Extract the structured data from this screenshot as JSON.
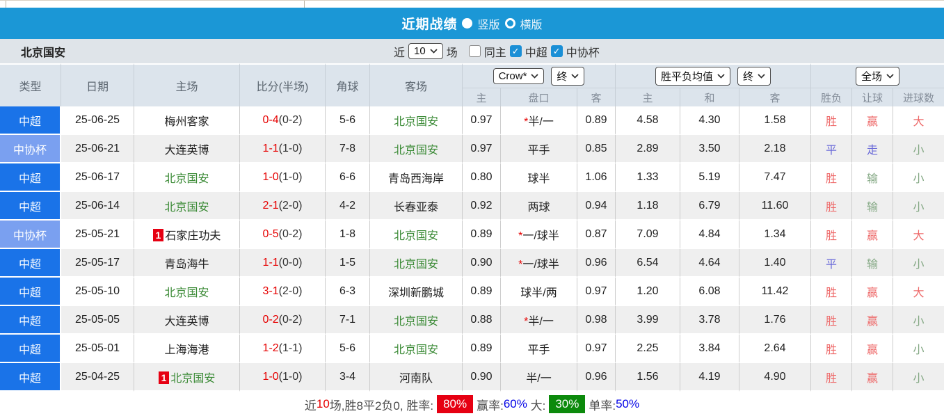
{
  "title_bar": {
    "title": "近期战绩",
    "radio_vertical": "竖版",
    "radio_horizontal": "横版"
  },
  "filter_bar": {
    "team": "北京国安",
    "recent_label": "近",
    "recent_value": "10",
    "matches_label": "场",
    "same_venue_label": "同主",
    "league_label": "中超",
    "cup_label": "中协杯",
    "same_venue_checked": false,
    "league_checked": true,
    "cup_checked": true
  },
  "table": {
    "headers_left": [
      "类型",
      "日期",
      "主场",
      "比分(半场)",
      "角球",
      "客场"
    ],
    "controls": {
      "bookmaker_select": "Crow*",
      "bookmaker_period_select": "终",
      "avg_select": "胜平负均值",
      "avg_period_select": "终",
      "scope_select": "全场"
    },
    "sub_headers": [
      "主",
      "盘口",
      "客",
      "主",
      "和",
      "客",
      "胜负",
      "让球",
      "进球数"
    ],
    "rows": [
      {
        "type": "中超",
        "is_cup": false,
        "date": "25-06-25",
        "home": "梅州客家",
        "home_focus": false,
        "home_badge": "",
        "score": "0-4",
        "half": "(0-2)",
        "corners": "5-6",
        "away": "北京国安",
        "away_focus": true,
        "odds_home": "0.97",
        "handicap_star": true,
        "handicap": "半/一",
        "odds_away": "0.89",
        "avg_home": "4.58",
        "avg_draw": "4.30",
        "avg_away": "1.58",
        "result": "胜",
        "result_color": "red",
        "handicap_result": "赢",
        "handicap_result_color": "red",
        "goals": "大",
        "goals_color": "red"
      },
      {
        "type": "中协杯",
        "is_cup": true,
        "date": "25-06-21",
        "home": "大连英博",
        "home_focus": false,
        "home_badge": "",
        "score": "1-1",
        "half": "(1-0)",
        "corners": "7-8",
        "away": "北京国安",
        "away_focus": true,
        "odds_home": "0.97",
        "handicap_star": false,
        "handicap": "平手",
        "odds_away": "0.85",
        "avg_home": "2.89",
        "avg_draw": "3.50",
        "avg_away": "2.18",
        "result": "平",
        "result_color": "blue",
        "handicap_result": "走",
        "handicap_result_color": "blue",
        "goals": "小",
        "goals_color": "green"
      },
      {
        "type": "中超",
        "is_cup": false,
        "date": "25-06-17",
        "home": "北京国安",
        "home_focus": true,
        "home_badge": "",
        "score": "1-0",
        "half": "(1-0)",
        "corners": "6-6",
        "away": "青岛西海岸",
        "away_focus": false,
        "odds_home": "0.80",
        "handicap_star": false,
        "handicap": "球半",
        "odds_away": "1.06",
        "avg_home": "1.33",
        "avg_draw": "5.19",
        "avg_away": "7.47",
        "result": "胜",
        "result_color": "red",
        "handicap_result": "输",
        "handicap_result_color": "green",
        "goals": "小",
        "goals_color": "green"
      },
      {
        "type": "中超",
        "is_cup": false,
        "date": "25-06-14",
        "home": "北京国安",
        "home_focus": true,
        "home_badge": "",
        "score": "2-1",
        "half": "(2-0)",
        "corners": "4-2",
        "away": "长春亚泰",
        "away_focus": false,
        "odds_home": "0.92",
        "handicap_star": false,
        "handicap": "两球",
        "odds_away": "0.94",
        "avg_home": "1.18",
        "avg_draw": "6.79",
        "avg_away": "11.60",
        "result": "胜",
        "result_color": "red",
        "handicap_result": "输",
        "handicap_result_color": "green",
        "goals": "小",
        "goals_color": "green"
      },
      {
        "type": "中协杯",
        "is_cup": true,
        "date": "25-05-21",
        "home": "石家庄功夫",
        "home_focus": false,
        "home_badge": "1",
        "score": "0-5",
        "half": "(0-2)",
        "corners": "1-8",
        "away": "北京国安",
        "away_focus": true,
        "odds_home": "0.89",
        "handicap_star": true,
        "handicap": "一/球半",
        "odds_away": "0.87",
        "avg_home": "7.09",
        "avg_draw": "4.84",
        "avg_away": "1.34",
        "result": "胜",
        "result_color": "red",
        "handicap_result": "赢",
        "handicap_result_color": "red",
        "goals": "大",
        "goals_color": "red"
      },
      {
        "type": "中超",
        "is_cup": false,
        "date": "25-05-17",
        "home": "青岛海牛",
        "home_focus": false,
        "home_badge": "",
        "score": "1-1",
        "half": "(0-0)",
        "corners": "1-5",
        "away": "北京国安",
        "away_focus": true,
        "odds_home": "0.90",
        "handicap_star": true,
        "handicap": "一/球半",
        "odds_away": "0.96",
        "avg_home": "6.54",
        "avg_draw": "4.64",
        "avg_away": "1.40",
        "result": "平",
        "result_color": "blue",
        "handicap_result": "输",
        "handicap_result_color": "green",
        "goals": "小",
        "goals_color": "green"
      },
      {
        "type": "中超",
        "is_cup": false,
        "date": "25-05-10",
        "home": "北京国安",
        "home_focus": true,
        "home_badge": "",
        "score": "3-1",
        "half": "(2-0)",
        "corners": "6-3",
        "away": "深圳新鹏城",
        "away_focus": false,
        "odds_home": "0.89",
        "handicap_star": false,
        "handicap": "球半/两",
        "odds_away": "0.97",
        "avg_home": "1.20",
        "avg_draw": "6.08",
        "avg_away": "11.42",
        "result": "胜",
        "result_color": "red",
        "handicap_result": "赢",
        "handicap_result_color": "red",
        "goals": "大",
        "goals_color": "red"
      },
      {
        "type": "中超",
        "is_cup": false,
        "date": "25-05-05",
        "home": "大连英博",
        "home_focus": false,
        "home_badge": "",
        "score": "0-2",
        "half": "(0-2)",
        "corners": "7-1",
        "away": "北京国安",
        "away_focus": true,
        "odds_home": "0.88",
        "handicap_star": true,
        "handicap": "半/一",
        "odds_away": "0.98",
        "avg_home": "3.99",
        "avg_draw": "3.78",
        "avg_away": "1.76",
        "result": "胜",
        "result_color": "red",
        "handicap_result": "赢",
        "handicap_result_color": "red",
        "goals": "小",
        "goals_color": "green"
      },
      {
        "type": "中超",
        "is_cup": false,
        "date": "25-05-01",
        "home": "上海海港",
        "home_focus": false,
        "home_badge": "",
        "score": "1-2",
        "half": "(1-1)",
        "corners": "5-6",
        "away": "北京国安",
        "away_focus": true,
        "odds_home": "0.89",
        "handicap_star": false,
        "handicap": "平手",
        "odds_away": "0.97",
        "avg_home": "2.25",
        "avg_draw": "3.84",
        "avg_away": "2.64",
        "result": "胜",
        "result_color": "red",
        "handicap_result": "赢",
        "handicap_result_color": "red",
        "goals": "小",
        "goals_color": "green"
      },
      {
        "type": "中超",
        "is_cup": false,
        "date": "25-04-25",
        "home": "北京国安",
        "home_focus": true,
        "home_badge": "1",
        "score": "1-0",
        "half": "(1-0)",
        "corners": "3-4",
        "away": "河南队",
        "away_focus": false,
        "odds_home": "0.90",
        "handicap_star": false,
        "handicap": "半/一",
        "odds_away": "0.96",
        "avg_home": "1.56",
        "avg_draw": "4.19",
        "avg_away": "4.90",
        "result": "胜",
        "result_color": "red",
        "handicap_result": "赢",
        "handicap_result_color": "red",
        "goals": "小",
        "goals_color": "green"
      }
    ]
  },
  "summary": {
    "parts": [
      {
        "text": "近",
        "style": "plain"
      },
      {
        "text": "10",
        "style": "red-text"
      },
      {
        "text": "场,胜8平2负0, 胜率:",
        "style": "plain"
      },
      {
        "text": "80%",
        "style": "badge-red"
      },
      {
        "text": "赢率:",
        "style": "plain"
      },
      {
        "text": "60%",
        "style": "blue-text"
      },
      {
        "text": " 大:",
        "style": "plain"
      },
      {
        "text": "30%",
        "style": "badge-green"
      },
      {
        "text": "单率:",
        "style": "plain"
      },
      {
        "text": "50%",
        "style": "blue-text"
      }
    ]
  },
  "colors": {
    "top_bar": "#1b97d6",
    "league_type_bg": "#1a73e8",
    "cup_type_bg": "#7aa0f0",
    "focus_team_green": "#3a8a35",
    "score_red": "#e60000",
    "result_red": "#ee6a6a",
    "result_blue": "#6a6ad8",
    "result_green": "#84a884",
    "badge_red": "#e60012",
    "badge_green": "#0c8a0c",
    "summary_blue": "#0000e6",
    "handicap_col_bg": "#fbf6ed",
    "avg_col_bg": "#edf4fa",
    "header_bg": "#dce4ec",
    "row_alt_bg": "#efefef"
  }
}
